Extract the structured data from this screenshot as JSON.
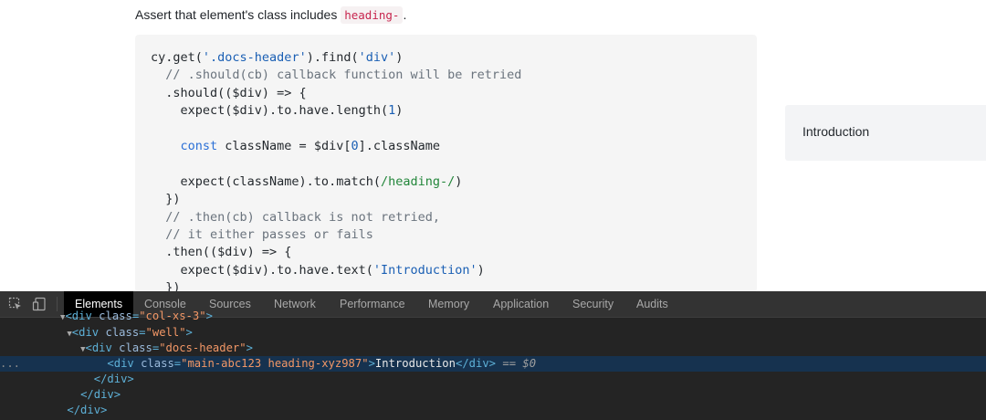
{
  "doc": {
    "intro_prefix": "Assert that element's class includes",
    "intro_code": "heading-",
    "intro_suffix": "."
  },
  "code": {
    "l1a": "cy.get(",
    "l1b": "'.docs-header'",
    "l1c": ").find(",
    "l1d": "'div'",
    "l1e": ")",
    "l2": "  // .should(cb) callback function will be retried",
    "l3": "  .should(($div) => {",
    "l4a": "    expect($div).to.have.length(",
    "l4b": "1",
    "l4c": ")",
    "l5": "",
    "l6a": "    ",
    "l6b": "const",
    "l6c": " className = $div[",
    "l6d": "0",
    "l6e": "].className",
    "l7": "",
    "l8a": "    expect(className).to.match(",
    "l8b": "/heading-/",
    "l8c": ")",
    "l9": "  })",
    "l10": "  // .then(cb) callback is not retried,",
    "l11": "  // it either passes or fails",
    "l12": "  .then(($div) => {",
    "l13a": "    expect($div).to.have.text(",
    "l13b": "'Introduction'",
    "l13c": ")",
    "l14": "  })"
  },
  "result": {
    "text": "Introduction"
  },
  "devtools": {
    "icons": {
      "inspect": "inspect-element-icon",
      "device": "device-toolbar-icon"
    },
    "tabs": [
      {
        "label": "Elements",
        "active": true
      },
      {
        "label": "Console"
      },
      {
        "label": "Sources"
      },
      {
        "label": "Network"
      },
      {
        "label": "Performance"
      },
      {
        "label": "Memory"
      },
      {
        "label": "Application"
      },
      {
        "label": "Security"
      },
      {
        "label": "Audits"
      }
    ],
    "dom": {
      "l0_tag": "<div ",
      "l0_attr": "class",
      "l0_eq": "=",
      "l0_val": "\"col-xs-3\"",
      "l0_end": ">",
      "l1_tri": "▼",
      "l1_open": "<div ",
      "l1_attr": "class",
      "l1_eq": "=",
      "l1_val": "\"well\"",
      "l1_end": ">",
      "l2_tri": "▼",
      "l2_open": "<div ",
      "l2_attr": "class",
      "l2_eq": "=",
      "l2_val": "\"docs-header\"",
      "l2_end": ">",
      "l3_dots": "...",
      "l3_open": "<div ",
      "l3_attr": "class",
      "l3_eq": "=",
      "l3_val": "\"main-abc123 heading-xyz987\"",
      "l3_gt": ">",
      "l3_text": "Introduction",
      "l3_close": "</div>",
      "l3_marker": " == $0",
      "l4": "</div>",
      "l5": "</div>",
      "l6": "</div>"
    },
    "colors": {
      "tabbar_bg": "#333333",
      "panel_bg": "#242424",
      "selected_row": "#16324f",
      "tag": "#5db0d7",
      "attr_value": "#f29766"
    }
  }
}
